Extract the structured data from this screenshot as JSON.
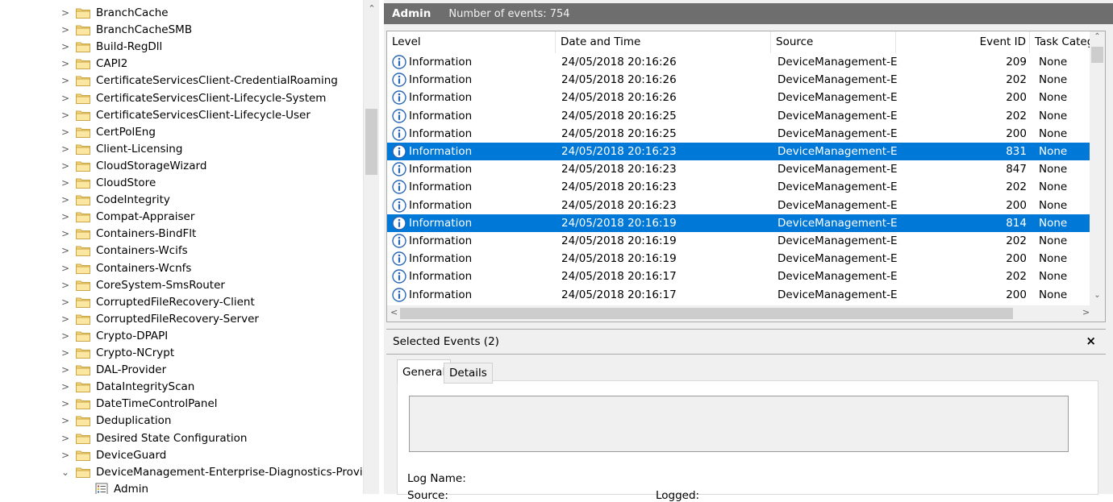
{
  "tree": {
    "items": [
      {
        "label": "BranchCache",
        "chevron": ">"
      },
      {
        "label": "BranchCacheSMB",
        "chevron": ">"
      },
      {
        "label": "Build-RegDll",
        "chevron": ">"
      },
      {
        "label": "CAPI2",
        "chevron": ">"
      },
      {
        "label": "CertificateServicesClient-CredentialRoaming",
        "chevron": ">"
      },
      {
        "label": "CertificateServicesClient-Lifecycle-System",
        "chevron": ">"
      },
      {
        "label": "CertificateServicesClient-Lifecycle-User",
        "chevron": ">"
      },
      {
        "label": "CertPolEng",
        "chevron": ">"
      },
      {
        "label": "Client-Licensing",
        "chevron": ">"
      },
      {
        "label": "CloudStorageWizard",
        "chevron": ">"
      },
      {
        "label": "CloudStore",
        "chevron": ">"
      },
      {
        "label": "CodeIntegrity",
        "chevron": ">"
      },
      {
        "label": "Compat-Appraiser",
        "chevron": ">"
      },
      {
        "label": "Containers-BindFlt",
        "chevron": ">"
      },
      {
        "label": "Containers-Wcifs",
        "chevron": ">"
      },
      {
        "label": "Containers-Wcnfs",
        "chevron": ">"
      },
      {
        "label": "CoreSystem-SmsRouter",
        "chevron": ">"
      },
      {
        "label": "CorruptedFileRecovery-Client",
        "chevron": ">"
      },
      {
        "label": "CorruptedFileRecovery-Server",
        "chevron": ">"
      },
      {
        "label": "Crypto-DPAPI",
        "chevron": ">"
      },
      {
        "label": "Crypto-NCrypt",
        "chevron": ">"
      },
      {
        "label": "DAL-Provider",
        "chevron": ">"
      },
      {
        "label": "DataIntegrityScan",
        "chevron": ">"
      },
      {
        "label": "DateTimeControlPanel",
        "chevron": ">"
      },
      {
        "label": "Deduplication",
        "chevron": ">"
      },
      {
        "label": "Desired State Configuration",
        "chevron": ">"
      },
      {
        "label": "DeviceGuard",
        "chevron": ">"
      },
      {
        "label": "DeviceManagement-Enterprise-Diagnostics-Provider",
        "chevron": "⌄"
      }
    ],
    "child": {
      "label": "Admin"
    }
  },
  "header": {
    "title": "Admin",
    "count": "Number of events: 754"
  },
  "grid": {
    "columns": [
      "Level",
      "Date and Time",
      "Source",
      "Event ID",
      "Task Categ"
    ],
    "rows": [
      {
        "level": "Information",
        "datetime": "24/05/2018 20:16:26",
        "source": "DeviceManagement-E...",
        "event_id": "209",
        "task": "None",
        "selected": false
      },
      {
        "level": "Information",
        "datetime": "24/05/2018 20:16:26",
        "source": "DeviceManagement-E...",
        "event_id": "202",
        "task": "None",
        "selected": false
      },
      {
        "level": "Information",
        "datetime": "24/05/2018 20:16:26",
        "source": "DeviceManagement-E...",
        "event_id": "200",
        "task": "None",
        "selected": false
      },
      {
        "level": "Information",
        "datetime": "24/05/2018 20:16:25",
        "source": "DeviceManagement-E...",
        "event_id": "202",
        "task": "None",
        "selected": false
      },
      {
        "level": "Information",
        "datetime": "24/05/2018 20:16:25",
        "source": "DeviceManagement-E...",
        "event_id": "200",
        "task": "None",
        "selected": false
      },
      {
        "level": "Information",
        "datetime": "24/05/2018 20:16:23",
        "source": "DeviceManagement-E...",
        "event_id": "831",
        "task": "None",
        "selected": true
      },
      {
        "level": "Information",
        "datetime": "24/05/2018 20:16:23",
        "source": "DeviceManagement-E...",
        "event_id": "847",
        "task": "None",
        "selected": false
      },
      {
        "level": "Information",
        "datetime": "24/05/2018 20:16:23",
        "source": "DeviceManagement-E...",
        "event_id": "202",
        "task": "None",
        "selected": false
      },
      {
        "level": "Information",
        "datetime": "24/05/2018 20:16:23",
        "source": "DeviceManagement-E...",
        "event_id": "200",
        "task": "None",
        "selected": false
      },
      {
        "level": "Information",
        "datetime": "24/05/2018 20:16:19",
        "source": "DeviceManagement-E...",
        "event_id": "814",
        "task": "None",
        "selected": true
      },
      {
        "level": "Information",
        "datetime": "24/05/2018 20:16:19",
        "source": "DeviceManagement-E...",
        "event_id": "202",
        "task": "None",
        "selected": false
      },
      {
        "level": "Information",
        "datetime": "24/05/2018 20:16:19",
        "source": "DeviceManagement-E...",
        "event_id": "200",
        "task": "None",
        "selected": false
      },
      {
        "level": "Information",
        "datetime": "24/05/2018 20:16:17",
        "source": "DeviceManagement-E...",
        "event_id": "202",
        "task": "None",
        "selected": false
      },
      {
        "level": "Information",
        "datetime": "24/05/2018 20:16:17",
        "source": "DeviceManagement-E...",
        "event_id": "200",
        "task": "None",
        "selected": false
      }
    ]
  },
  "details": {
    "title": "Selected Events (2)",
    "close": "×",
    "tabs": [
      "General",
      "Details"
    ],
    "log_name_label": "Log Name:",
    "source_label": "Source:",
    "logged_label": "Logged:"
  },
  "icons": {
    "folder": "folder-icon",
    "info": "information-icon",
    "event_log": "event-log-icon"
  },
  "colors": {
    "selection": "#0078d7",
    "header_bar": "#6e6e6e",
    "info_icon": "#2a67b8",
    "folder": "#f5d57c"
  }
}
